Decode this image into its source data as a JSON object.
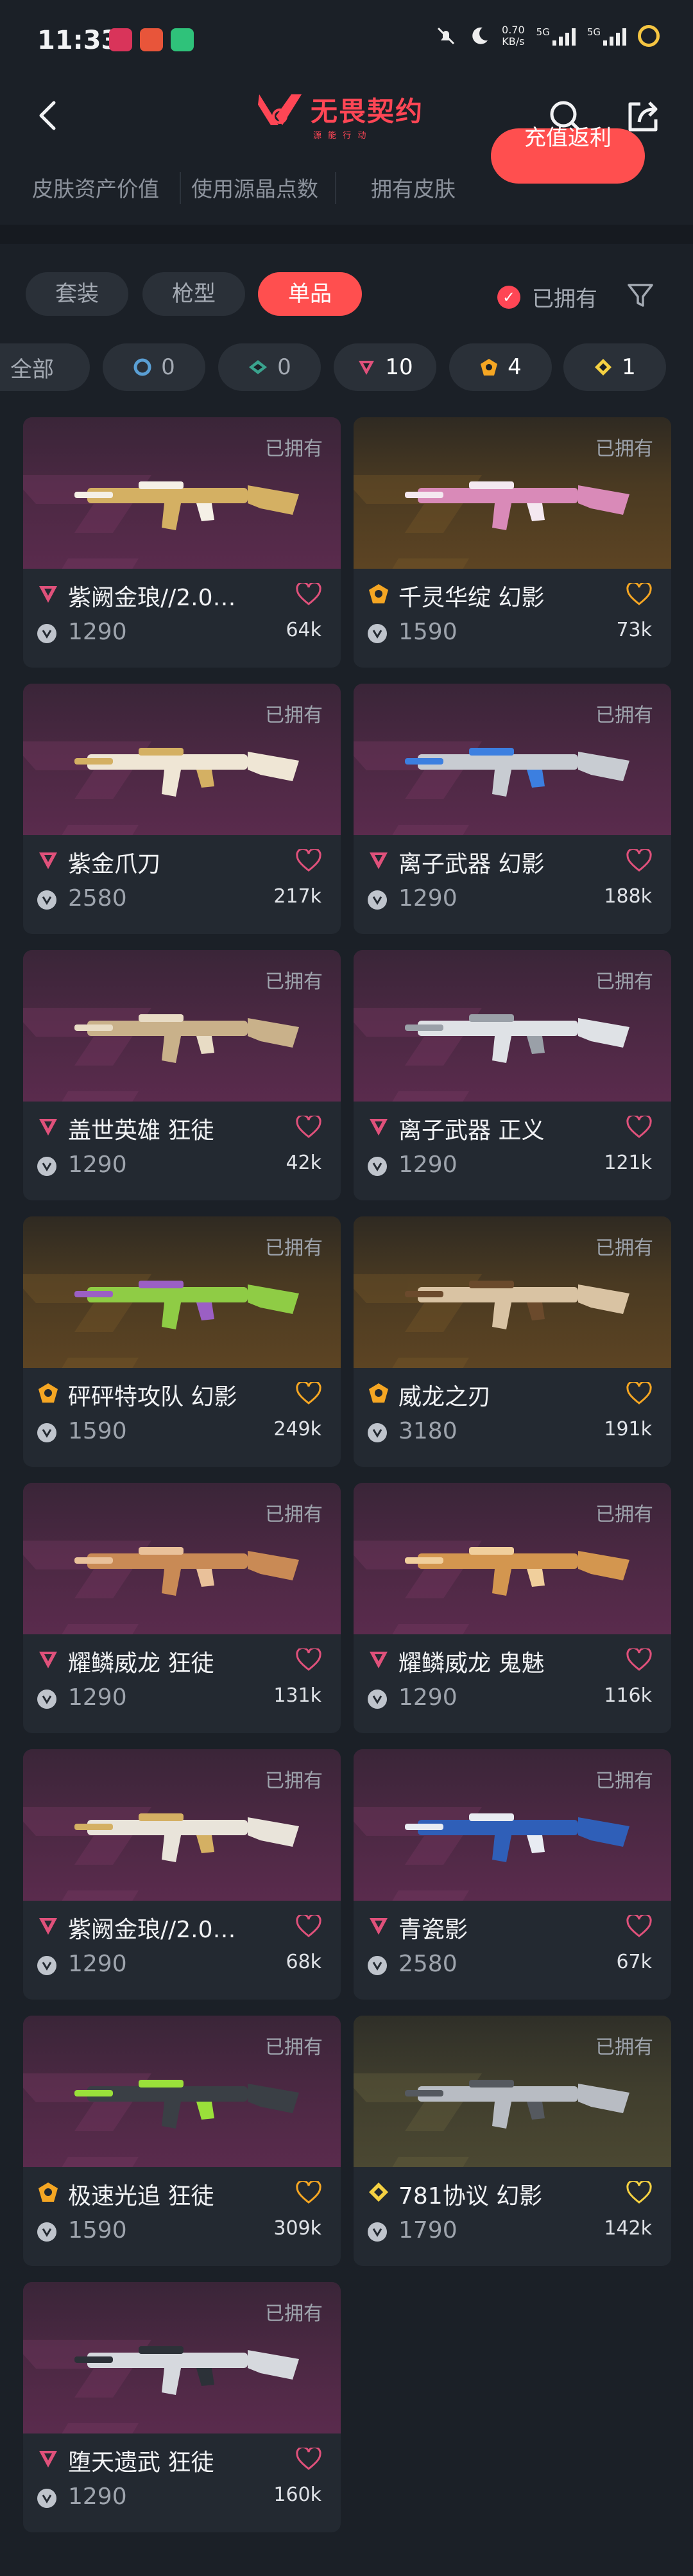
{
  "status": {
    "time": "11:33",
    "net_speed": "0.70",
    "net_unit": "KB/s",
    "sig1": "5G",
    "sig2": "5G",
    "app_colors": [
      "#d9345a",
      "#e8553a",
      "#2fc27a"
    ]
  },
  "header": {
    "logo_text": "无畏契约",
    "logo_sub": "源 能 行 动",
    "accent": "#ff4655"
  },
  "stats": {
    "labels": [
      "皮肤资产价值",
      "使用源晶点数",
      "拥有皮肤"
    ],
    "recharge_label": "充值返利"
  },
  "tabs": {
    "items": [
      "套装",
      "枪型",
      "单品"
    ],
    "active_index": 2,
    "owned_label": "已拥有"
  },
  "chips": [
    {
      "label": "全部",
      "count": ""
    },
    {
      "label": "",
      "count": "0",
      "tier": "select",
      "color": "#5a9fd4"
    },
    {
      "label": "",
      "count": "0",
      "tier": "deluxe",
      "color": "#3aa38e"
    },
    {
      "label": "",
      "count": "10",
      "tier": "premium",
      "color": "#e0517b"
    },
    {
      "label": "",
      "count": "4",
      "tier": "exclusive",
      "color": "#f5a623"
    },
    {
      "label": "",
      "count": "1",
      "tier": "ultra",
      "color": "#f5d142"
    }
  ],
  "cards": [
    {
      "name": "紫阙金琅//2.0…",
      "price": "1290",
      "likes": "64k",
      "owned": "已拥有",
      "tier": "premium",
      "tier_color": "#e0517b",
      "heart_color": "#e0517b",
      "bg": "purple",
      "weapon_color": "#d4b063",
      "weapon_accent": "#f5f0e6"
    },
    {
      "name": "千灵华绽 幻影",
      "price": "1590",
      "likes": "73k",
      "owned": "已拥有",
      "tier": "exclusive",
      "tier_color": "#f5a623",
      "heart_color": "#f5a623",
      "bg": "gold",
      "weapon_color": "#d98ab8",
      "weapon_accent": "#f4e8f0"
    },
    {
      "name": "紫金爪刀",
      "price": "2580",
      "likes": "217k",
      "owned": "已拥有",
      "tier": "premium",
      "tier_color": "#e0517b",
      "heart_color": "#e0517b",
      "bg": "purple",
      "weapon_color": "#efe6d5",
      "weapon_accent": "#d4b063"
    },
    {
      "name": "离子武器 幻影",
      "price": "1290",
      "likes": "188k",
      "owned": "已拥有",
      "tier": "premium",
      "tier_color": "#e0517b",
      "heart_color": "#e0517b",
      "bg": "purple",
      "weapon_color": "#c8ccd2",
      "weapon_accent": "#3c7fe0"
    },
    {
      "name": "盖世英雄 狂徒",
      "price": "1290",
      "likes": "42k",
      "owned": "已拥有",
      "tier": "premium",
      "tier_color": "#e0517b",
      "heart_color": "#e0517b",
      "bg": "purple",
      "weapon_color": "#c9b18a",
      "weapon_accent": "#e8dcc5"
    },
    {
      "name": "离子武器 正义",
      "price": "1290",
      "likes": "121k",
      "owned": "已拥有",
      "tier": "premium",
      "tier_color": "#e0517b",
      "heart_color": "#e0517b",
      "bg": "purple",
      "weapon_color": "#dfe2e6",
      "weapon_accent": "#9aa0a8"
    },
    {
      "name": "砰砰特攻队 幻影",
      "price": "1590",
      "likes": "249k",
      "owned": "已拥有",
      "tier": "exclusive",
      "tier_color": "#f5a623",
      "heart_color": "#f5a623",
      "bg": "gold",
      "weapon_color": "#8fcc45",
      "weapon_accent": "#9b5fc4"
    },
    {
      "name": "威龙之刃",
      "price": "3180",
      "likes": "191k",
      "owned": "已拥有",
      "tier": "exclusive",
      "tier_color": "#f5a623",
      "heart_color": "#f5a623",
      "bg": "gold",
      "weapon_color": "#d9c3a3",
      "weapon_accent": "#6b4a2c"
    },
    {
      "name": "耀鳞威龙 狂徒",
      "price": "1290",
      "likes": "131k",
      "owned": "已拥有",
      "tier": "premium",
      "tier_color": "#e0517b",
      "heart_color": "#e0517b",
      "bg": "purple",
      "weapon_color": "#c98a55",
      "weapon_accent": "#e9c19a"
    },
    {
      "name": "耀鳞威龙 鬼魅",
      "price": "1290",
      "likes": "116k",
      "owned": "已拥有",
      "tier": "premium",
      "tier_color": "#e0517b",
      "heart_color": "#e0517b",
      "bg": "purple",
      "weapon_color": "#d3964f",
      "weapon_accent": "#f0cf9c"
    },
    {
      "name": "紫阙金琅//2.0…",
      "price": "1290",
      "likes": "68k",
      "owned": "已拥有",
      "tier": "premium",
      "tier_color": "#e0517b",
      "heart_color": "#e0517b",
      "bg": "purple",
      "weapon_color": "#e9e4da",
      "weapon_accent": "#d4b063"
    },
    {
      "name": "青瓷影",
      "price": "2580",
      "likes": "67k",
      "owned": "已拥有",
      "tier": "premium",
      "tier_color": "#e0517b",
      "heart_color": "#e0517b",
      "bg": "purple",
      "weapon_color": "#2f5fb8",
      "weapon_accent": "#e8ecf2"
    },
    {
      "name": "极速光追 狂徒",
      "price": "1590",
      "likes": "309k",
      "owned": "已拥有",
      "tier": "exclusive",
      "tier_color": "#f5a623",
      "heart_color": "#f5a623",
      "bg": "purple",
      "weapon_color": "#3a3f45",
      "weapon_accent": "#9ae03a"
    },
    {
      "name": "781协议 幻影",
      "price": "1790",
      "likes": "142k",
      "owned": "已拥有",
      "tier": "ultra",
      "tier_color": "#f5d142",
      "heart_color": "#f5d142",
      "bg": "olive",
      "weapon_color": "#b8bcc3",
      "weapon_accent": "#55595f"
    },
    {
      "name": "堕天遗武 狂徒",
      "price": "1290",
      "likes": "160k",
      "owned": "已拥有",
      "tier": "premium",
      "tier_color": "#e0517b",
      "heart_color": "#e0517b",
      "bg": "purple",
      "weapon_color": "#d6d9de",
      "weapon_accent": "#2c3138"
    }
  ]
}
